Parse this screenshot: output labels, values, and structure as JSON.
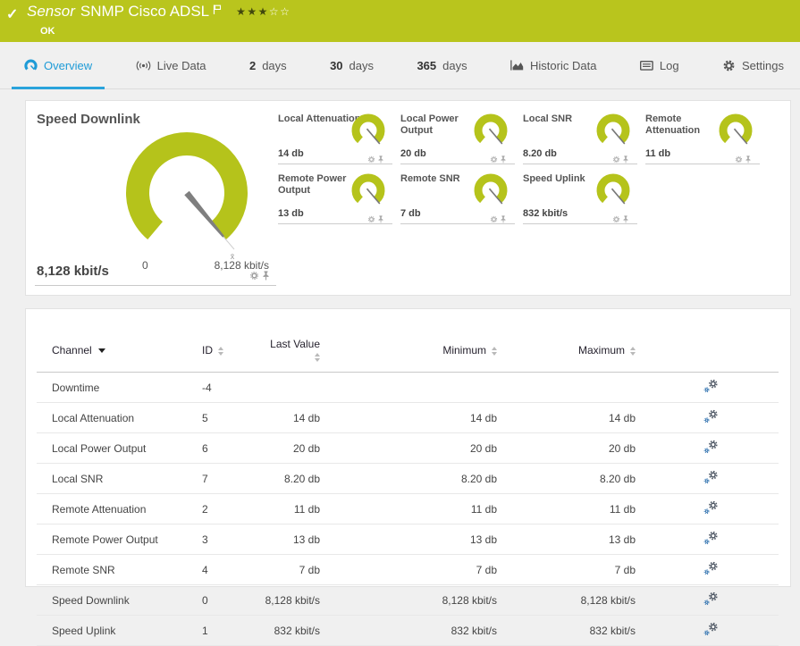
{
  "colors": {
    "brand_green": "#b9c51d",
    "accent_blue": "#1e9bd7",
    "gauge_lime": "#b5c31b",
    "needle_gray": "#7f7f7f"
  },
  "topbar": {
    "status_icon": "✓",
    "kind": "Sensor",
    "title": "SNMP Cisco ADSL",
    "status": "OK",
    "priority": {
      "stars_filled": "★★★",
      "stars_empty": "☆☆",
      "filled_count": 3,
      "total": 5
    },
    "flag_icon": "flag-icon"
  },
  "tabs": [
    {
      "icon": "gauge-icon",
      "label": "Overview",
      "active": true
    },
    {
      "icon": "live-data-icon",
      "label": "Live Data"
    },
    {
      "num": "2",
      "label": "days"
    },
    {
      "num": "30",
      "label": "days"
    },
    {
      "num": "365",
      "label": "days"
    },
    {
      "icon": "historic-data-icon",
      "label": "Historic Data"
    },
    {
      "icon": "log-icon",
      "label": "Log"
    },
    {
      "icon": "settings-gear-icon",
      "label": "Settings"
    }
  ],
  "main_gauge": {
    "title": "Speed Downlink",
    "value": "8,128 kbit/s",
    "scale_min": "0",
    "scale_max": "8,128 kbit/s",
    "avg_marker": "x̄"
  },
  "mini_gauges": [
    {
      "title": "Local Attenuation",
      "value": "14 db"
    },
    {
      "title": "Local Power Output",
      "value": "20 db"
    },
    {
      "title": "Local SNR",
      "value": "8.20 db"
    },
    {
      "title": "Remote Attenuation",
      "value": "11 db"
    },
    {
      "title": "Remote Power Output",
      "value": "13 db"
    },
    {
      "title": "Remote SNR",
      "value": "7 db"
    },
    {
      "title": "Speed Uplink",
      "value": "832 kbit/s"
    }
  ],
  "table": {
    "headers": {
      "channel": "Channel",
      "id": "ID",
      "last": "Last Value",
      "min": "Minimum",
      "max": "Maximum"
    },
    "rows": [
      {
        "channel": "Downtime",
        "id": "-4",
        "last": "",
        "min": "",
        "max": ""
      },
      {
        "channel": "Local Attenuation",
        "id": "5",
        "last": "14 db",
        "min": "14 db",
        "max": "14 db"
      },
      {
        "channel": "Local Power Output",
        "id": "6",
        "last": "20 db",
        "min": "20 db",
        "max": "20 db"
      },
      {
        "channel": "Local SNR",
        "id": "7",
        "last": "8.20 db",
        "min": "8.20 db",
        "max": "8.20 db"
      },
      {
        "channel": "Remote Attenuation",
        "id": "2",
        "last": "11 db",
        "min": "11 db",
        "max": "11 db"
      },
      {
        "channel": "Remote Power Output",
        "id": "3",
        "last": "13 db",
        "min": "13 db",
        "max": "13 db"
      },
      {
        "channel": "Remote SNR",
        "id": "4",
        "last": "7 db",
        "min": "7 db",
        "max": "7 db"
      },
      {
        "channel": "Speed Downlink",
        "id": "0",
        "last": "8,128 kbit/s",
        "min": "8,128 kbit/s",
        "max": "8,128 kbit/s"
      },
      {
        "channel": "Speed Uplink",
        "id": "1",
        "last": "832 kbit/s",
        "min": "832 kbit/s",
        "max": "832 kbit/s"
      }
    ]
  }
}
